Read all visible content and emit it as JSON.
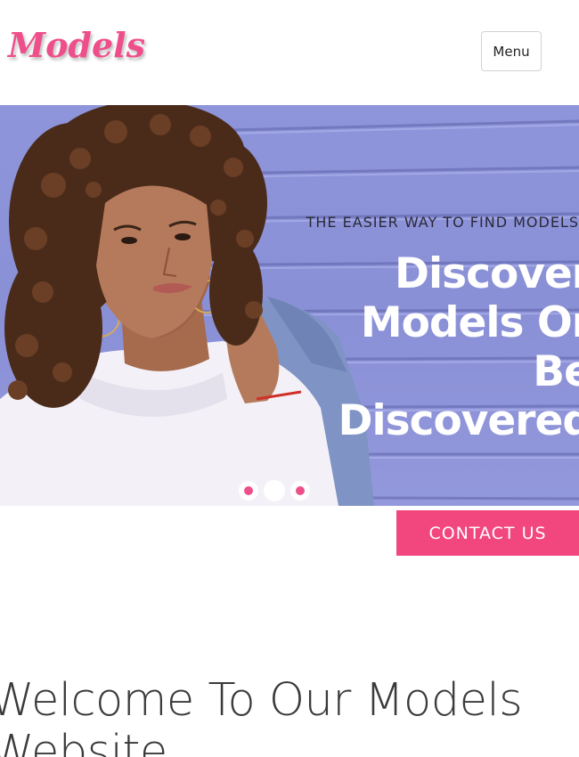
{
  "header": {
    "logo_text": "Models",
    "menu_label": "Menu"
  },
  "hero": {
    "tagline": "THE EASIER WAY TO FIND MODELS",
    "headline": "Discover Models Or Be Discovered",
    "slider": {
      "slides": 3,
      "active_index": 1
    },
    "contact_label": "CONTACT US"
  },
  "welcome": {
    "title": "Welcome To Our Models Website"
  },
  "colors": {
    "brand_pink": "#ee4f8a",
    "button_pink": "#f2467f",
    "hero_background": "#8f95da"
  }
}
